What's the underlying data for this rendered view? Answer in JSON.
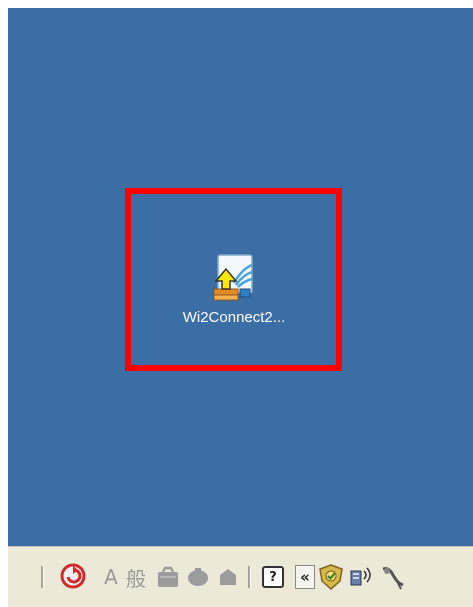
{
  "desktop": {
    "background_color": "#3a6ea5",
    "icons": [
      {
        "label": "Wi2Connect2...",
        "icon": "wi2connect-setup-icon",
        "highlighted": true
      }
    ],
    "highlight_color": "#ff0000"
  },
  "taskbar": {
    "ime_mode_text": "A",
    "ime_kanji_text": "般",
    "help_label": "?",
    "expand_tray_label": "«",
    "tray_icons": [
      "norton-security-icon",
      "network-icon",
      "satellite-icon"
    ]
  }
}
